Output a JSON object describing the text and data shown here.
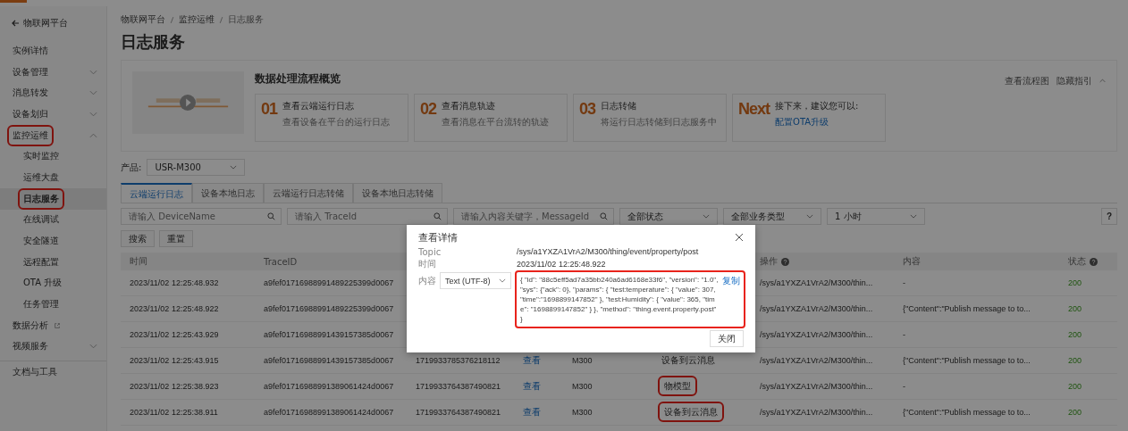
{
  "sidebar": {
    "items": [
      {
        "label": "物联网平台",
        "kind": "back"
      },
      {
        "label": "实例详情",
        "kind": "group",
        "selected": false
      },
      {
        "label": "设备管理",
        "kind": "group",
        "expanded": false,
        "selected": false
      },
      {
        "label": "消息转发",
        "kind": "group",
        "expanded": false,
        "selected": false
      },
      {
        "label": "设备划归",
        "kind": "group",
        "expanded": false,
        "selected": false
      },
      {
        "label": "监控运维",
        "kind": "group",
        "expanded": true,
        "selected": false,
        "highlighted": true
      },
      {
        "label": "实时监控",
        "kind": "sub",
        "selected": false
      },
      {
        "label": "运维大盘",
        "kind": "sub",
        "selected": false
      },
      {
        "label": "日志服务",
        "kind": "sub",
        "selected": true,
        "highlighted": true
      },
      {
        "label": "在线调试",
        "kind": "sub",
        "selected": false
      },
      {
        "label": "安全隧道",
        "kind": "sub",
        "selected": false
      },
      {
        "label": "远程配置",
        "kind": "sub",
        "selected": false
      },
      {
        "label": "OTA 升级",
        "kind": "sub",
        "selected": false
      },
      {
        "label": "任务管理",
        "kind": "sub",
        "selected": false
      },
      {
        "label": "数据分析",
        "kind": "external",
        "selected": false
      },
      {
        "label": "视频服务",
        "kind": "group",
        "expanded": false,
        "selected": false
      },
      {
        "label": "文档与工具",
        "kind": "section",
        "selected": false
      }
    ]
  },
  "breadcrumb": [
    "物联网平台",
    "监控运维",
    "日志服务"
  ],
  "page_title": "日志服务",
  "overview": {
    "title": "数据处理流程概览",
    "links": [
      "查看流程图",
      "隐藏指引"
    ],
    "steps": [
      {
        "num": "01",
        "title": "查看云端运行日志",
        "desc": "查看设备在平台的运行日志"
      },
      {
        "num": "02",
        "title": "查看消息轨迹",
        "desc": "查看消息在平台流转的轨迹"
      },
      {
        "num": "03",
        "title": "日志转储",
        "desc": "将运行日志转储到日志服务中"
      },
      {
        "num": "Next",
        "title": "接下来，建议您可以:",
        "link": "配置OTA升级"
      }
    ]
  },
  "product": {
    "label": "产品:",
    "value": "USR-M300"
  },
  "tabs": [
    {
      "label": "云端运行日志",
      "selected": true
    },
    {
      "label": "设备本地日志",
      "selected": false
    },
    {
      "label": "云端运行日志转储",
      "selected": false
    },
    {
      "label": "设备本地日志转储",
      "selected": false
    }
  ],
  "filters": {
    "inputs": [
      {
        "placeholder": "请输入 DeviceName"
      },
      {
        "placeholder": "请输入 TraceId"
      },
      {
        "placeholder": "请输入内容关键字，MessageId"
      }
    ],
    "selects": [
      "全部状态",
      "全部业务类型",
      "1 小时"
    ],
    "help": "?",
    "buttons": [
      "搜索",
      "重置"
    ]
  },
  "table": {
    "columns": [
      {
        "label": "时间"
      },
      {
        "label": "TraceID"
      },
      {},
      {},
      {},
      {},
      {
        "label": "操作",
        "help": true
      },
      {
        "label": "内容"
      },
      {
        "label": "状态",
        "help": true
      }
    ],
    "rows": [
      [
        {
          "text": "2023/11/02 12:25:48.932"
        },
        {
          "text": "a9fef01716988991489225399d0067"
        },
        {},
        {},
        {},
        {},
        {
          "text": "/sys/a1YXZA1VrA2/M300/thin..."
        },
        {
          "text": "-"
        },
        {
          "text": "200",
          "kind": "status"
        }
      ],
      [
        {
          "text": "2023/11/02 12:25:48.922"
        },
        {
          "text": "a9fef01716988991489225399d0067"
        },
        {},
        {},
        {},
        {},
        {
          "text": "/sys/a1YXZA1VrA2/M300/thin..."
        },
        {
          "text": "{\"Content\":\"Publish message to to..."
        },
        {
          "text": "200",
          "kind": "status"
        }
      ],
      [
        {
          "text": "2023/11/02 12:25:43.929"
        },
        {
          "text": "a9fef01716988991439157385d0067"
        },
        {},
        {},
        {},
        {},
        {
          "text": "/sys/a1YXZA1VrA2/M300/thin..."
        },
        {
          "text": "-"
        },
        {
          "text": "200",
          "kind": "status"
        }
      ],
      [
        {
          "text": "2023/11/02 12:25:43.915"
        },
        {
          "text": "a9fef01716988991439157385d0067"
        },
        {
          "text": "1719933785376218112"
        },
        {
          "text": "查看",
          "kind": "link"
        },
        {
          "text": "M300"
        },
        {
          "text": "设备到云消息"
        },
        {
          "text": "/sys/a1YXZA1VrA2/M300/thin..."
        },
        {
          "text": "{\"Content\":\"Publish message to to..."
        },
        {
          "text": "200",
          "kind": "status"
        }
      ],
      [
        {
          "text": "2023/11/02 12:25:38.923"
        },
        {
          "text": "a9fef01716988991389061424d0067"
        },
        {
          "text": "1719933764387490821"
        },
        {
          "text": "查看",
          "kind": "link"
        },
        {
          "text": "M300"
        },
        {
          "text": "物模型",
          "highlighted": true
        },
        {
          "text": "/sys/a1YXZA1VrA2/M300/thin..."
        },
        {
          "text": "-"
        },
        {
          "text": "200",
          "kind": "status"
        }
      ],
      [
        {
          "text": "2023/11/02 12:25:38.911"
        },
        {
          "text": "a9fef01716988991389061424d0067"
        },
        {
          "text": "1719933764387490821"
        },
        {
          "text": "查看",
          "kind": "link"
        },
        {
          "text": "M300"
        },
        {
          "text": "设备到云消息",
          "highlighted": true
        },
        {
          "text": "/sys/a1YXZA1VrA2/M300/thin..."
        },
        {
          "text": "{\"Content\":\"Publish message to to..."
        },
        {
          "text": "200",
          "kind": "status"
        }
      ]
    ]
  },
  "modal": {
    "title": "查看详情",
    "topic_label": "Topic",
    "topic": "/sys/a1YXZA1VrA2/M300/thing/event/property/post",
    "time_label": "时间",
    "time": "2023/11/02 12:25:48.922",
    "content_label": "内容",
    "encoding": "Text (UTF-8)",
    "content": "{ \"id\": \"88c5eff5ad7a35bb240a6ad6168e33f6\", \"version\": \"1.0\", \"sys\": {\"ack\": 0}, \"params\": { \"test:temperature\": { \"value\": 307, \"time\":\"1698899147852\" }, \"test:Humidity\": { \"value\": 365, \"time\": \"1698899147852\" } }, \"method\": \"thing.event.property.post\" }",
    "content_highlighted": true,
    "copy": "复制",
    "close": "关闭"
  }
}
